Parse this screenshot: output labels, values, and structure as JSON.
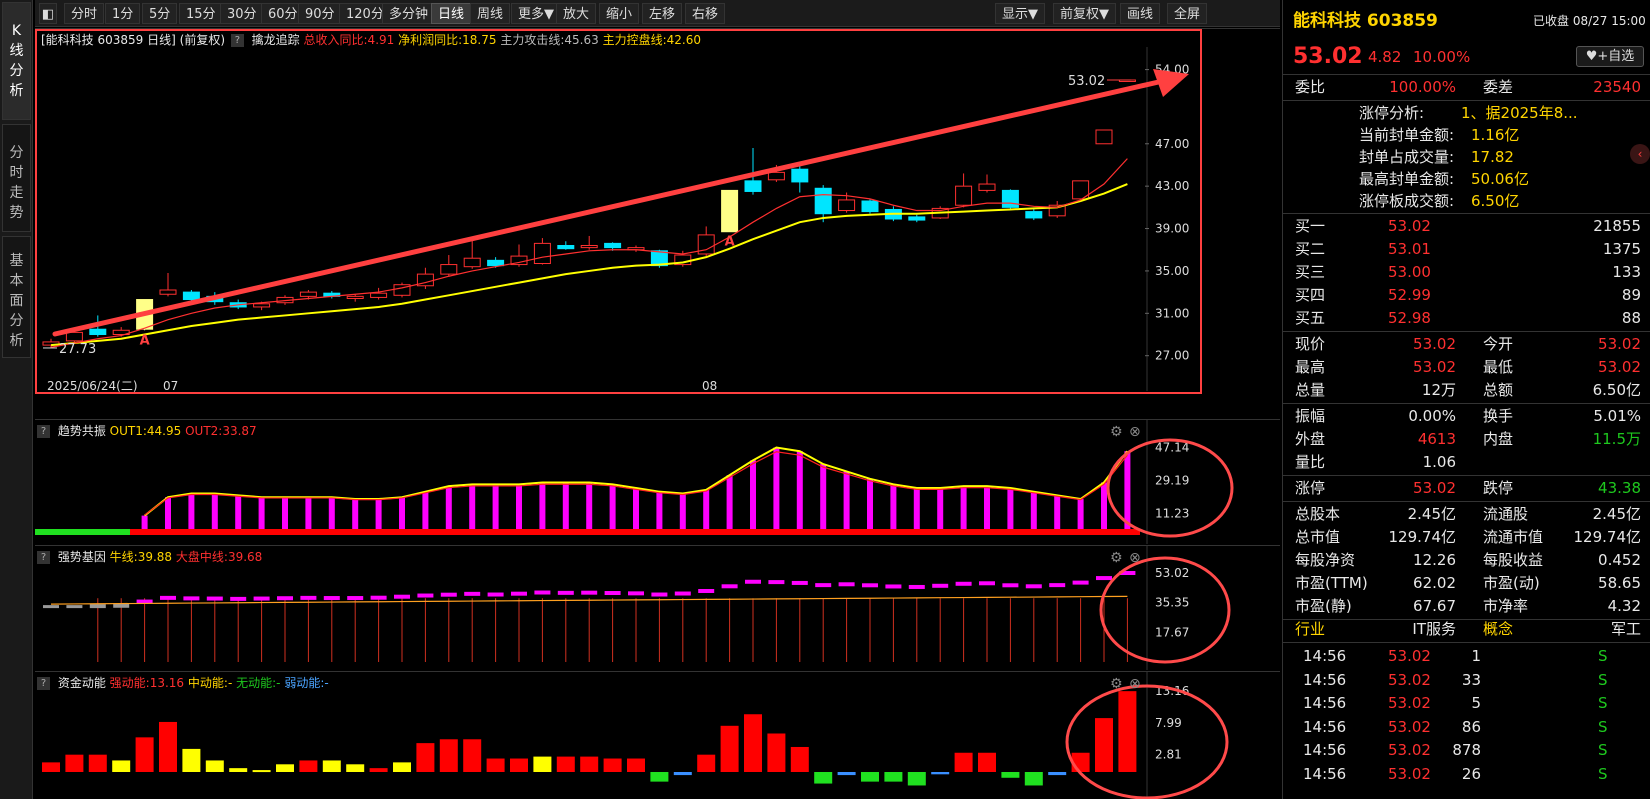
{
  "left_tabs": [
    {
      "label": "K线分析",
      "active": true
    },
    {
      "label": "分时走势",
      "active": false
    },
    {
      "label": "基本面分析",
      "active": false
    }
  ],
  "toolbar": {
    "left_buttons": [
      "分时",
      "1分",
      "5分",
      "15分",
      "30分",
      "60分",
      "90分",
      "120分",
      "多分钟",
      "日线",
      "周线",
      "更多▼",
      "放大",
      "缩小",
      "左移",
      "右移"
    ],
    "active": "日线",
    "right_buttons": [
      "显示▼",
      "前复权▼",
      "画线",
      "全屏"
    ]
  },
  "kline": {
    "title": "[能科科技 603859 日线]",
    "adjust": "(前复权)",
    "indicator_name": "擒龙追踪",
    "revenue_yoy": "总收入同比:4.91",
    "profit_yoy": "净利润同比:18.75",
    "attack_line": "主力攻击线:45.63",
    "control_line": "主力控盘线:42.60",
    "y_ticks": [
      "54.00",
      "47.00",
      "43.00",
      "39.00",
      "35.00",
      "31.00",
      "27.00"
    ],
    "high_label": "53.02",
    "low_label": "27.73",
    "date_labels": [
      "2025/06/24(二)",
      "07",
      "08"
    ],
    "signal_marker": "A",
    "colors": {
      "up": "#ff3030",
      "down": "#00e5ff",
      "ma1": "#ff3030",
      "ma2": "#ffff00",
      "arrow": "#ff4040",
      "limit": "#ffff88"
    }
  },
  "trend": {
    "name": "趋势共振",
    "out1": "OUT1:44.95",
    "out2": "OUT2:33.87",
    "y_ticks": [
      "47.14",
      "29.19",
      "11.23"
    ]
  },
  "strength": {
    "name": "强势基因",
    "bull": "牛线:39.88",
    "market": "大盘中线:39.68",
    "y_ticks": [
      "53.02",
      "35.35",
      "17.67"
    ]
  },
  "capital": {
    "name": "资金动能",
    "strong": "强动能:13.16",
    "mid": "中动能:-",
    "none": "无动能:-",
    "weak": "弱动能:-",
    "y_ticks": [
      "13.16",
      "7.99",
      "2.81"
    ]
  },
  "chart_data": {
    "type": "candlestick",
    "title": "能科科技 603859 日线",
    "ylim": [
      26.5,
      55
    ],
    "candles": [
      {
        "o": 28.0,
        "c": 28.3,
        "h": 28.6,
        "l": 27.73
      },
      {
        "o": 28.4,
        "c": 29.2,
        "h": 29.4,
        "l": 28.1
      },
      {
        "o": 29.5,
        "c": 29.0,
        "h": 30.8,
        "l": 28.8
      },
      {
        "o": 29.0,
        "c": 29.4,
        "h": 29.7,
        "l": 28.8
      },
      {
        "o": 29.5,
        "c": 32.3,
        "h": 32.3,
        "l": 29.4
      },
      {
        "o": 32.8,
        "c": 33.2,
        "h": 34.8,
        "l": 32.6
      },
      {
        "o": 33.0,
        "c": 32.3,
        "h": 33.2,
        "l": 32.0
      },
      {
        "o": 32.6,
        "c": 32.1,
        "h": 33.0,
        "l": 31.8
      },
      {
        "o": 32.0,
        "c": 31.6,
        "h": 32.3,
        "l": 31.4
      },
      {
        "o": 31.6,
        "c": 31.9,
        "h": 32.1,
        "l": 31.3
      },
      {
        "o": 32.0,
        "c": 32.5,
        "h": 32.7,
        "l": 31.8
      },
      {
        "o": 32.6,
        "c": 33.0,
        "h": 33.2,
        "l": 32.3
      },
      {
        "o": 32.9,
        "c": 32.6,
        "h": 33.1,
        "l": 32.4
      },
      {
        "o": 32.4,
        "c": 32.6,
        "h": 32.8,
        "l": 32.1
      },
      {
        "o": 32.5,
        "c": 32.9,
        "h": 33.4,
        "l": 32.3
      },
      {
        "o": 32.7,
        "c": 33.7,
        "h": 33.9,
        "l": 32.5
      },
      {
        "o": 33.6,
        "c": 34.7,
        "h": 35.3,
        "l": 33.3
      },
      {
        "o": 34.7,
        "c": 35.6,
        "h": 36.5,
        "l": 34.5
      },
      {
        "o": 35.4,
        "c": 36.2,
        "h": 38.0,
        "l": 35.2
      },
      {
        "o": 36.0,
        "c": 35.5,
        "h": 36.3,
        "l": 35.3
      },
      {
        "o": 35.6,
        "c": 36.4,
        "h": 37.5,
        "l": 35.4
      },
      {
        "o": 35.7,
        "c": 37.6,
        "h": 38.1,
        "l": 35.6
      },
      {
        "o": 37.4,
        "c": 37.1,
        "h": 37.8,
        "l": 37.0
      },
      {
        "o": 37.2,
        "c": 37.4,
        "h": 38.3,
        "l": 37.0
      },
      {
        "o": 37.6,
        "c": 37.2,
        "h": 37.7,
        "l": 36.9
      },
      {
        "o": 37.0,
        "c": 37.2,
        "h": 37.4,
        "l": 36.8
      },
      {
        "o": 36.9,
        "c": 35.5,
        "h": 37.0,
        "l": 35.3
      },
      {
        "o": 35.6,
        "c": 36.5,
        "h": 36.9,
        "l": 35.4
      },
      {
        "o": 36.6,
        "c": 38.4,
        "h": 39.2,
        "l": 36.4
      },
      {
        "o": 38.7,
        "c": 42.6,
        "h": 42.6,
        "l": 38.7
      },
      {
        "o": 43.5,
        "c": 42.5,
        "h": 46.6,
        "l": 42.2
      },
      {
        "o": 43.6,
        "c": 44.3,
        "h": 45.0,
        "l": 43.4
      },
      {
        "o": 44.6,
        "c": 43.4,
        "h": 45.2,
        "l": 42.4
      },
      {
        "o": 42.8,
        "c": 40.4,
        "h": 43.1,
        "l": 39.6
      },
      {
        "o": 40.7,
        "c": 41.7,
        "h": 42.4,
        "l": 40.5
      },
      {
        "o": 41.6,
        "c": 40.6,
        "h": 41.8,
        "l": 40.4
      },
      {
        "o": 40.8,
        "c": 39.9,
        "h": 41.1,
        "l": 39.7
      },
      {
        "o": 40.1,
        "c": 39.8,
        "h": 40.3,
        "l": 39.6
      },
      {
        "o": 40.0,
        "c": 40.9,
        "h": 41.1,
        "l": 39.9
      },
      {
        "o": 41.2,
        "c": 43.0,
        "h": 44.2,
        "l": 41.0
      },
      {
        "o": 42.6,
        "c": 43.2,
        "h": 44.1,
        "l": 42.4
      },
      {
        "o": 42.6,
        "c": 41.0,
        "h": 42.7,
        "l": 40.8
      },
      {
        "o": 40.6,
        "c": 40.0,
        "h": 40.9,
        "l": 39.8
      },
      {
        "o": 40.2,
        "c": 41.2,
        "h": 41.6,
        "l": 40.0
      },
      {
        "o": 41.8,
        "c": 43.5,
        "h": 43.5,
        "l": 41.6
      },
      {
        "o": 47.0,
        "c": 48.3,
        "h": 48.3,
        "l": 47.0
      },
      {
        "o": 53.02,
        "c": 53.02,
        "h": 53.02,
        "l": 53.02
      }
    ],
    "ma_fast": [
      27.8,
      28.2,
      28.6,
      28.9,
      29.6,
      30.4,
      31.0,
      31.5,
      31.8,
      32.0,
      32.2,
      32.4,
      32.6,
      32.8,
      33.0,
      33.4,
      33.9,
      34.5,
      35.0,
      35.4,
      35.8,
      36.3,
      36.6,
      36.9,
      37.0,
      37.0,
      36.8,
      36.6,
      37.0,
      38.2,
      39.6,
      40.9,
      42.0,
      42.2,
      42.1,
      41.8,
      41.2,
      40.7,
      40.7,
      41.1,
      41.4,
      41.4,
      41.1,
      41.0,
      41.7,
      43.2,
      45.6
    ],
    "ma_slow": [
      28.0,
      28.2,
      28.4,
      28.6,
      29.0,
      29.4,
      29.8,
      30.1,
      30.4,
      30.6,
      30.8,
      31.0,
      31.2,
      31.4,
      31.6,
      31.9,
      32.3,
      32.7,
      33.1,
      33.5,
      33.9,
      34.3,
      34.7,
      35.0,
      35.3,
      35.5,
      35.6,
      35.8,
      36.3,
      37.1,
      38.0,
      38.8,
      39.6,
      40.0,
      40.2,
      40.3,
      40.4,
      40.4,
      40.5,
      40.6,
      40.7,
      40.8,
      40.9,
      41.0,
      41.6,
      42.3,
      43.2
    ],
    "trend_bars": [
      0,
      0,
      0,
      0,
      10,
      20,
      22,
      22,
      21,
      20,
      20,
      20,
      20,
      19,
      19,
      20,
      23,
      26,
      27,
      27,
      27,
      28,
      28,
      28,
      27,
      25,
      23,
      22,
      24,
      32,
      40,
      47,
      45,
      38,
      34,
      30,
      27,
      25,
      25,
      26,
      26,
      25,
      23,
      21,
      19,
      28,
      45
    ],
    "strength_close": [
      0,
      0,
      33.3,
      33.5,
      36.0,
      38.2,
      37.9,
      37.8,
      37.6,
      37.8,
      38.0,
      38.2,
      38.1,
      38.1,
      38.3,
      38.9,
      39.6,
      40.1,
      40.6,
      40.2,
      40.7,
      41.4,
      41.2,
      41.3,
      41.1,
      40.9,
      40.2,
      40.8,
      42.3,
      45.1,
      47.8,
      47.6,
      47.1,
      45.8,
      46.3,
      45.7,
      45.0,
      44.7,
      45.4,
      46.6,
      46.9,
      45.7,
      45.1,
      45.8,
      47.3,
      50.0,
      53.02
    ],
    "capital_bars": [
      2.5,
      4.5,
      4.5,
      3.0,
      9.0,
      13.0,
      6.0,
      3.0,
      1.0,
      0.5,
      2.0,
      3.0,
      3.0,
      2.0,
      1.0,
      2.5,
      7.5,
      8.5,
      8.5,
      3.5,
      3.5,
      4.0,
      4.0,
      4.0,
      3.5,
      3.5,
      -2.5,
      -0.8,
      4.5,
      12.0,
      15.0,
      10.0,
      6.5,
      -3.0,
      -0.8,
      -2.5,
      -2.5,
      -3.5,
      -0.6,
      5.0,
      5.0,
      -1.5,
      -3.5,
      -0.8,
      5.0,
      14.0,
      21.0
    ]
  },
  "quote": {
    "name": "能科科技 603859",
    "status": "已收盘 08/27 15:00",
    "price": "53.02",
    "change": "4.82",
    "pct": "10.00%",
    "watch_btn": "+自选",
    "wb_label": "委比",
    "wb_val": "100.00%",
    "wc_label": "委差",
    "wc_val": "23540",
    "limit_info": [
      {
        "label": "涨停分析:",
        "value": "1、据2025年8..."
      },
      {
        "label": "当前封单金额:",
        "value": "1.16亿"
      },
      {
        "label": "封单占成交量:",
        "value": "17.82"
      },
      {
        "label": "最高封单金额:",
        "value": "50.06亿"
      },
      {
        "label": "涨停板成交额:",
        "value": "6.50亿"
      }
    ],
    "bids": [
      {
        "label": "买一",
        "price": "53.02",
        "vol": "21855"
      },
      {
        "label": "买二",
        "price": "53.01",
        "vol": "1375"
      },
      {
        "label": "买三",
        "price": "53.00",
        "vol": "133"
      },
      {
        "label": "买四",
        "price": "52.99",
        "vol": "89"
      },
      {
        "label": "买五",
        "price": "52.98",
        "vol": "88"
      }
    ],
    "stats1": [
      {
        "l1": "现价",
        "v1": "53.02",
        "c1": "red",
        "l2": "今开",
        "v2": "53.02",
        "c2": "red"
      },
      {
        "l1": "最高",
        "v1": "53.02",
        "c1": "red",
        "l2": "最低",
        "v2": "53.02",
        "c2": "red"
      },
      {
        "l1": "总量",
        "v1": "12万",
        "c1": "white",
        "l2": "总额",
        "v2": "6.50亿",
        "c2": "white"
      }
    ],
    "stats2": [
      {
        "l1": "振幅",
        "v1": "0.00%",
        "c1": "white",
        "l2": "换手",
        "v2": "5.01%",
        "c2": "white"
      },
      {
        "l1": "外盘",
        "v1": "4613",
        "c1": "red",
        "l2": "内盘",
        "v2": "11.5万",
        "c2": "green"
      },
      {
        "l1": "量比",
        "v1": "1.06",
        "c1": "white",
        "l2": "",
        "v2": "",
        "c2": "white"
      }
    ],
    "stats3": [
      {
        "l1": "涨停",
        "v1": "53.02",
        "c1": "red",
        "l2": "跌停",
        "v2": "43.38",
        "c2": "green"
      }
    ],
    "stats4": [
      {
        "l1": "总股本",
        "v1": "2.45亿",
        "c1": "white",
        "l2": "流通股",
        "v2": "2.45亿",
        "c2": "white"
      },
      {
        "l1": "总市值",
        "v1": "129.74亿",
        "c1": "white",
        "l2": "流通市值",
        "v2": "129.74亿",
        "c2": "white"
      },
      {
        "l1": "每股净资",
        "v1": "12.26",
        "c1": "white",
        "l2": "每股收益",
        "v2": "0.452",
        "c2": "white"
      },
      {
        "l1": "市盈(TTM)",
        "v1": "62.02",
        "c1": "white",
        "l2": "市盈(动)",
        "v2": "58.65",
        "c2": "white"
      },
      {
        "l1": "市盈(静)",
        "v1": "67.67",
        "c1": "white",
        "l2": "市净率",
        "v2": "4.32",
        "c2": "white"
      }
    ],
    "industry": {
      "l1": "行业",
      "v1": "IT服务",
      "l2": "概念",
      "v2": "军工"
    },
    "ticks": [
      {
        "time": "14:56",
        "price": "53.02",
        "vol": "1",
        "side": "S"
      },
      {
        "time": "14:56",
        "price": "53.02",
        "vol": "33",
        "side": "S"
      },
      {
        "time": "14:56",
        "price": "53.02",
        "vol": "5",
        "side": "S"
      },
      {
        "time": "14:56",
        "price": "53.02",
        "vol": "86",
        "side": "S"
      },
      {
        "time": "14:56",
        "price": "53.02",
        "vol": "878",
        "side": "S"
      },
      {
        "time": "14:56",
        "price": "53.02",
        "vol": "26",
        "side": "S"
      }
    ]
  }
}
